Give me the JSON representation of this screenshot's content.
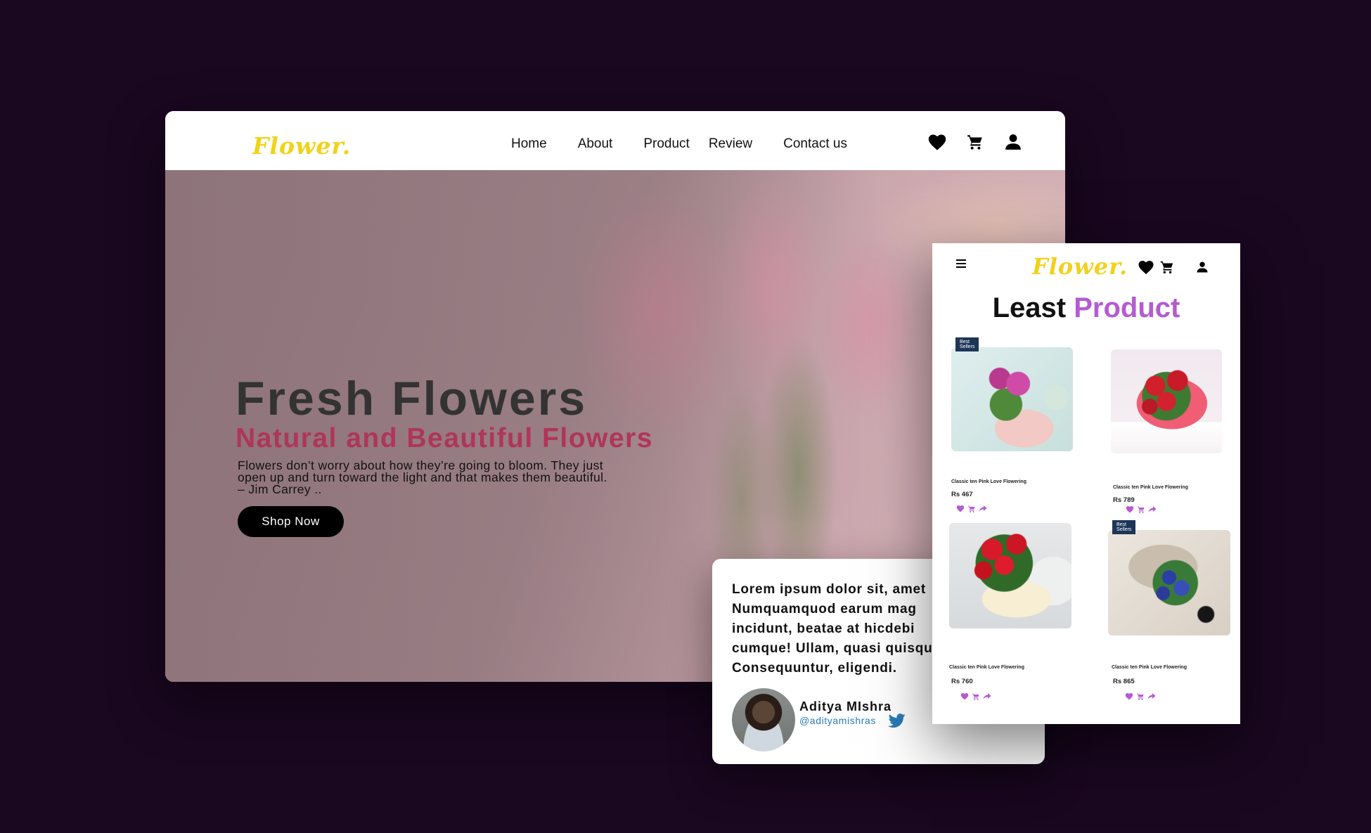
{
  "desktop": {
    "logo": "Flower.",
    "nav": [
      "Home",
      "About",
      "Product",
      "Review",
      "Contact us"
    ],
    "icons": [
      "heart-icon",
      "cart-icon",
      "user-icon"
    ],
    "hero": {
      "title": "Fresh Flowers",
      "subtitle": "Natural and Beautiful Flowers",
      "quote_lines": [
        "Flowers don’t worry about how they’re going to bloom. They just",
        "open up and turn toward the light and that makes them beautiful.",
        "– Jim Carrey .."
      ],
      "button": "Shop Now"
    }
  },
  "review": {
    "lines": [
      "Lorem ipsum dolor sit, amet",
      "Numquamquod earum mag",
      "incidunt, beatae at hicdebi",
      "cumque! Ullam, quasi quisqu",
      "Consequuntur, eligendi."
    ],
    "author": "Aditya MIshra",
    "handle": "@adityamishras",
    "icon": "twitter-icon"
  },
  "mobile": {
    "logo": "Flower.",
    "title_word1": "Least",
    "title_word2": "Product",
    "products": [
      {
        "badge": "Best Sellers",
        "name": "Classic ten Pink Love Flowering",
        "price": "Rs 467"
      },
      {
        "badge": "",
        "name": "Classic ten Pink Love Flowering",
        "price": "Rs 789"
      },
      {
        "badge": "",
        "name": "Classic ten Pink Love Flowering",
        "price": "Rs 760"
      },
      {
        "badge": "Best Sellers",
        "name": "Classic ten Pink Love Flowering",
        "price": "Rs 865"
      }
    ]
  },
  "colors": {
    "background": "#1a0720",
    "logo": "#f1d21a",
    "accent_purple": "#b55bd1",
    "hero_subtitle": "#b0355a",
    "twitter": "#2a7bb8"
  }
}
